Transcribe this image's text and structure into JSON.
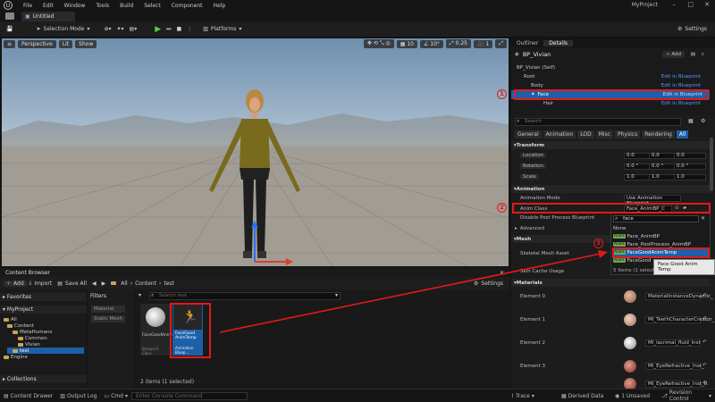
{
  "menubar": {
    "items": [
      "File",
      "Edit",
      "Window",
      "Tools",
      "Build",
      "Select",
      "Component",
      "Help"
    ],
    "project": "MyProject",
    "min": "–",
    "max": "□",
    "close": "✕"
  },
  "tab": {
    "title": "Untitled"
  },
  "toolbar": {
    "selection_mode": "Selection Mode",
    "platforms": "Platforms",
    "settings": "Settings"
  },
  "viewport": {
    "perspective": "Perspective",
    "lit": "Lit",
    "show": "Show",
    "grid_value": "10",
    "rot_value": "10°",
    "scale_value": "0.25",
    "cam_value": "1"
  },
  "outliner": {
    "tab_outliner": "Outliner",
    "tab_details": "Details",
    "title": "BP_Vivian",
    "add_label": "Add",
    "rows": [
      {
        "label": "BP_Vivian (Self)",
        "link": ""
      },
      {
        "label": "Root",
        "link": "Edit in Blueprint"
      },
      {
        "label": "Body",
        "link": "Edit in Blueprint"
      },
      {
        "label": "Face",
        "link": "Edit in Blueprint"
      },
      {
        "label": "Hair",
        "link": "Edit in Blueprint"
      }
    ]
  },
  "details": {
    "search_placeholder": "Search",
    "filters": [
      "General",
      "Animation",
      "LOD",
      "Misc",
      "Physics",
      "Rendering",
      "All"
    ],
    "transform_section": "Transform",
    "location": {
      "label": "Location",
      "values": [
        "0.0",
        "0.0",
        "0.0"
      ]
    },
    "rotation": {
      "label": "Rotation",
      "values": [
        "0.0 °",
        "0.0 °",
        "0.0 °"
      ]
    },
    "scale": {
      "label": "Scale",
      "values": [
        "1.0",
        "1.0",
        "1.0"
      ]
    },
    "animation_section": "Animation",
    "anim_mode": {
      "label": "Animation Mode",
      "value": "Use Animation Blueprint"
    },
    "anim_class": {
      "label": "Anim Class",
      "value": "Face_AnimBP_C"
    },
    "disable_pp": "Disable Post Process Blueprint",
    "advanced": "Advanced",
    "mesh_section": "Mesh",
    "skeletal_mesh": "Skeletal Mesh Asset",
    "skin_cache": "Skin Cache Usage",
    "materials_section": "Materials",
    "elements": [
      {
        "label": "Element 0",
        "value": "MaterialInstanceDynamic_"
      },
      {
        "label": "Element 1",
        "value": "MI_TeethCharacterCreator_"
      },
      {
        "label": "Element 2",
        "value": "MI_lacrimal_fluid_Inst"
      },
      {
        "label": "Element 3",
        "value": "MI_EyeRefractive_Inst_"
      },
      {
        "label": "Element 4",
        "value": "MI_EyeRefractive_Inst_R"
      }
    ]
  },
  "popup": {
    "search_value": "face",
    "none": "None",
    "items": [
      {
        "tag": "Anim",
        "label": "Face_AnimBP"
      },
      {
        "tag": "Anim",
        "label": "Face_PostProcess_AnimBP"
      },
      {
        "tag": "Anim",
        "label": "FaceGoodAnimTemp"
      },
      {
        "tag": "Anim",
        "label": "FaceGood"
      }
    ],
    "count": "5 items (1 selected)",
    "tooltip": "Face Good Anim Temp"
  },
  "content_browser": {
    "title": "Content Browser",
    "add": "Add",
    "import": "Import",
    "save_all": "Save All",
    "breadcrumb": [
      "All",
      "Content",
      "test"
    ],
    "settings": "Settings",
    "favorites": "Favorites",
    "project": "MyProject",
    "tree": [
      "All",
      "Content",
      "MetaHumans",
      "Common",
      "Vivian",
      "test",
      "Engine"
    ],
    "collections": "Collections",
    "filters_title": "Filters",
    "filter_chips": [
      "Material",
      "Static Mesh"
    ],
    "search_placeholder": "Search test",
    "assets": [
      {
        "name": "FaceGoodAnimTemp",
        "type": "Blueprint Class"
      },
      {
        "name": "FaceGood AnimTemp",
        "type": "Animation Bluep..."
      }
    ],
    "count": "2 items (1 selected)"
  },
  "statusbar": {
    "content_drawer": "Content Drawer",
    "output_log": "Output Log",
    "cmd": "Cmd",
    "console_placeholder": "Enter Console Command",
    "trace": "Trace",
    "derived_data": "Derived Data",
    "unsaved": "1 Unsaved",
    "revision_control": "Revision Control"
  },
  "annotations": {
    "m1": "1",
    "m2": "2",
    "m3": "3"
  },
  "colors": {
    "highlight": "#e01b1b",
    "selection": "#1d5fa8",
    "accent": "#4a9dff",
    "play": "#5ec750"
  }
}
